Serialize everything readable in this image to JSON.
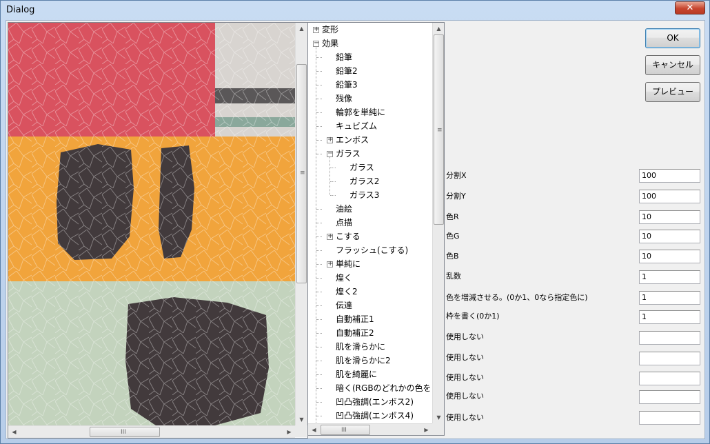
{
  "window": {
    "title": "Dialog",
    "close_glyph": "✕"
  },
  "buttons": {
    "ok": "OK",
    "cancel": "キャンセル",
    "preview": "プレビュー"
  },
  "tree": {
    "items": [
      {
        "label": "変形",
        "level": 0,
        "expander": "plus"
      },
      {
        "label": "効果",
        "level": 0,
        "expander": "minus"
      },
      {
        "label": "鉛筆",
        "level": 1
      },
      {
        "label": "鉛筆2",
        "level": 1
      },
      {
        "label": "鉛筆3",
        "level": 1
      },
      {
        "label": "残像",
        "level": 1
      },
      {
        "label": "輪郭を単純に",
        "level": 1
      },
      {
        "label": "キュビズム",
        "level": 1
      },
      {
        "label": "エンボス",
        "level": 1,
        "expander": "plus"
      },
      {
        "label": "ガラス",
        "level": 1,
        "expander": "minus"
      },
      {
        "label": "ガラス",
        "level": 2
      },
      {
        "label": "ガラス2",
        "level": 2
      },
      {
        "label": "ガラス3",
        "level": 2
      },
      {
        "label": "油絵",
        "level": 1
      },
      {
        "label": "点描",
        "level": 1
      },
      {
        "label": "こする",
        "level": 1,
        "expander": "plus"
      },
      {
        "label": "フラッシュ(こする)",
        "level": 1
      },
      {
        "label": "単純に",
        "level": 1,
        "expander": "plus"
      },
      {
        "label": "煌く",
        "level": 1
      },
      {
        "label": "煌く2",
        "level": 1
      },
      {
        "label": "伝達",
        "level": 1
      },
      {
        "label": "自動補正1",
        "level": 1
      },
      {
        "label": "自動補正2",
        "level": 1
      },
      {
        "label": "肌を滑らかに",
        "level": 1
      },
      {
        "label": "肌を滑らかに2",
        "level": 1
      },
      {
        "label": "肌を綺麗に",
        "level": 1
      },
      {
        "label": "暗く(RGBのどれかの色を",
        "level": 1
      },
      {
        "label": "凹凸強調(エンボス2)",
        "level": 1
      },
      {
        "label": "凹凸強調(エンボス4)",
        "level": 1
      }
    ]
  },
  "params": [
    {
      "label": "分割X",
      "value": "100"
    },
    {
      "label": "分割Y",
      "value": "100"
    },
    {
      "label": "色R",
      "value": "10"
    },
    {
      "label": "色G",
      "value": "10"
    },
    {
      "label": "色B",
      "value": "10"
    },
    {
      "label": "乱数",
      "value": "1"
    },
    {
      "label": "色を増減させる。(0か1、0なら指定色に)",
      "value": "1"
    },
    {
      "label": "枠を書く(0か1)",
      "value": "1"
    },
    {
      "label": "使用しない",
      "value": ""
    },
    {
      "label": "使用しない",
      "value": ""
    },
    {
      "label": "使用しない",
      "value": ""
    },
    {
      "label": "使用しない",
      "value": ""
    },
    {
      "label": "使用しない",
      "value": ""
    }
  ],
  "scroll_glyphs": {
    "up": "▲",
    "down": "▼",
    "left": "◀",
    "right": "▶",
    "grip_v": "≡",
    "grip_h": "III"
  },
  "colors": {
    "image_red": "#d9525f",
    "image_orange": "#f1a43c",
    "image_green": "#c3d3bd",
    "image_dark": "#423a3c",
    "image_gray": "#d8d4d0"
  },
  "icons": {
    "close": "close-icon",
    "expand": "plus-box-icon",
    "collapse": "minus-box-icon"
  }
}
